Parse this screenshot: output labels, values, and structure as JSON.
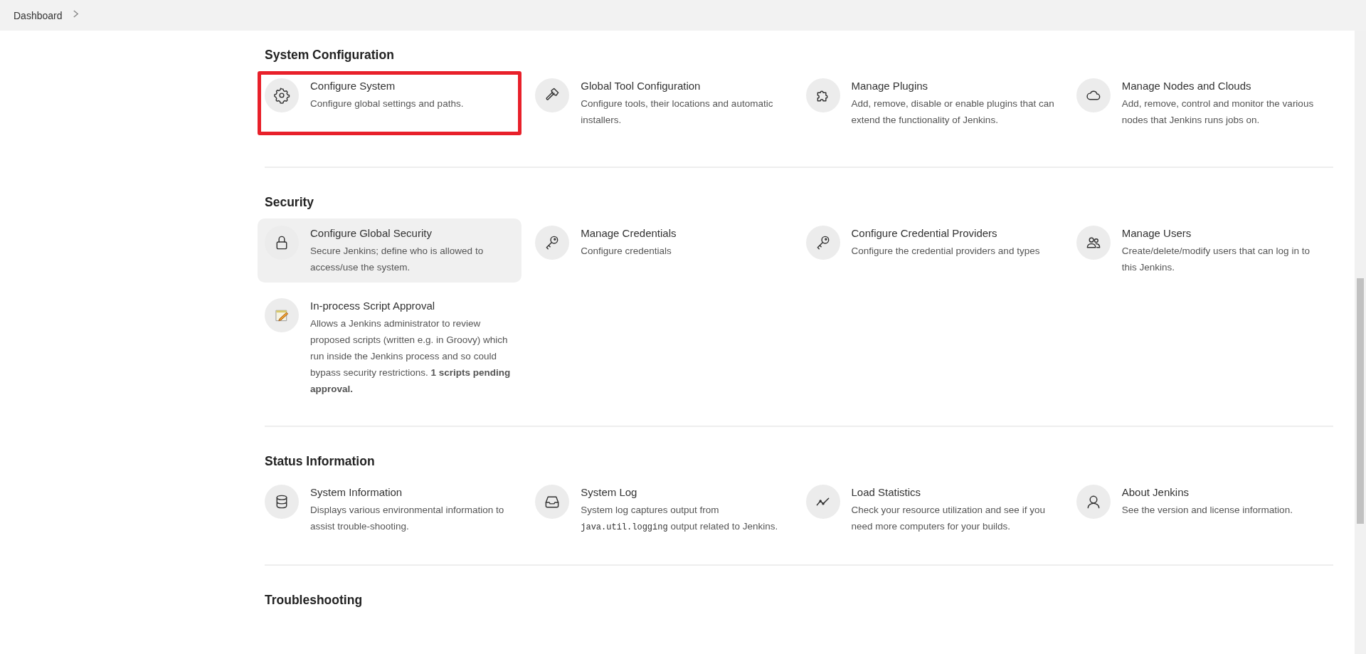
{
  "breadcrumb": {
    "items": [
      "Dashboard"
    ]
  },
  "sections": [
    {
      "title": "System Configuration",
      "items": [
        {
          "title": "Configure System",
          "description": "Configure global settings and paths.",
          "highlighted": true,
          "hovered": false
        },
        {
          "title": "Global Tool Configuration",
          "description": "Configure tools, their locations and automatic installers.",
          "highlighted": false,
          "hovered": false
        },
        {
          "title": "Manage Plugins",
          "description": "Add, remove, disable or enable plugins that can extend the functionality of Jenkins.",
          "highlighted": false,
          "hovered": false
        },
        {
          "title": "Manage Nodes and Clouds",
          "description": "Add, remove, control and monitor the various nodes that Jenkins runs jobs on.",
          "highlighted": false,
          "hovered": false
        }
      ]
    },
    {
      "title": "Security",
      "items": [
        {
          "title": "Configure Global Security",
          "description": "Secure Jenkins; define who is allowed to access/use the system.",
          "highlighted": false,
          "hovered": true
        },
        {
          "title": "Manage Credentials",
          "description": "Configure credentials",
          "highlighted": false,
          "hovered": false
        },
        {
          "title": "Configure Credential Providers",
          "description": "Configure the credential providers and types",
          "highlighted": false,
          "hovered": false
        },
        {
          "title": "Manage Users",
          "description": "Create/delete/modify users that can log in to this Jenkins.",
          "highlighted": false,
          "hovered": false
        },
        {
          "title": "In-process Script Approval",
          "description": "Allows a Jenkins administrator to review proposed scripts (written e.g. in Groovy) which run inside the Jenkins process and so could bypass security restrictions. **1 scripts pending approval.**",
          "highlighted": false,
          "hovered": false
        }
      ]
    },
    {
      "title": "Status Information",
      "items": [
        {
          "title": "System Information",
          "description": "Displays various environmental information to assist trouble-shooting.",
          "highlighted": false,
          "hovered": false
        },
        {
          "title": "System Log",
          "description_parts": [
            {
              "kind": "text",
              "text": "System log captures output from "
            },
            {
              "kind": "code",
              "text": "java.util.logging"
            },
            {
              "kind": "text",
              "text": " output related to Jenkins."
            }
          ],
          "highlighted": false,
          "hovered": false
        },
        {
          "title": "Load Statistics",
          "description": "Check your resource utilization and see if you need more computers for your builds.",
          "highlighted": false,
          "hovered": false
        },
        {
          "title": "About Jenkins",
          "description": "See the version and license information.",
          "highlighted": false,
          "hovered": false
        }
      ]
    },
    {
      "title": "Troubleshooting"
    }
  ]
}
